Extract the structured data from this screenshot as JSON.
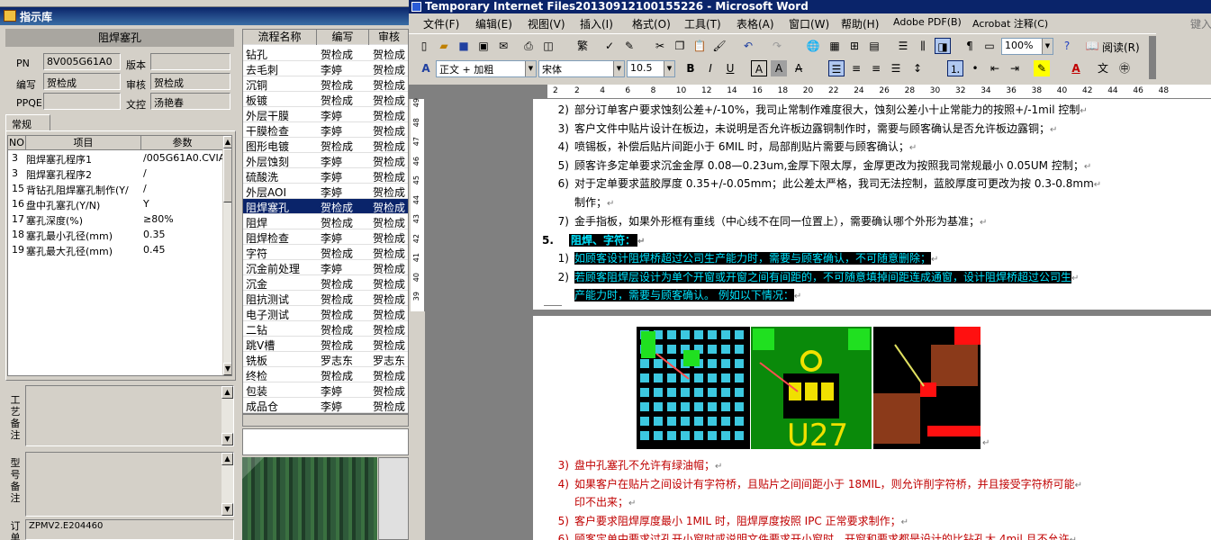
{
  "left_window": {
    "title": "指示库",
    "panel_title": "阻焊塞孔",
    "fields": {
      "pn_label": "PN",
      "pn_value": "8V005G61A0",
      "version_label": "版本",
      "version_value": "",
      "author_label": "编写",
      "author_value": "贺检成",
      "review_label": "审核",
      "review_value": "贺检成",
      "ppqe_label": "PPQE",
      "ppqe_value": "",
      "control_label": "文控",
      "control_value": "汤艳春"
    },
    "tab_regular": "常规",
    "grid_headers": [
      "NO",
      "项目",
      "参数"
    ],
    "grid_rows": [
      {
        "no": "3",
        "item": "阻焊塞孔程序1",
        "param": "/005G61A0.CVIA"
      },
      {
        "no": "3",
        "item": "阻焊塞孔程序2",
        "param": "/"
      },
      {
        "no": "15",
        "item": "背钻孔阻焊塞孔制作(Y/",
        "param": "/"
      },
      {
        "no": "16",
        "item": "盘中孔塞孔(Y/N)",
        "param": "Y"
      },
      {
        "no": "17",
        "item": "塞孔深度(%)",
        "param": "≥80%"
      },
      {
        "no": "18",
        "item": "塞孔最小孔径(mm)",
        "param": "0.35"
      },
      {
        "no": "19",
        "item": "塞孔最大孔径(mm)",
        "param": "0.45"
      }
    ],
    "memo1_label": "工艺备注",
    "memo2_label": "型号备注",
    "memo3_label": "订单",
    "memo3_value": "ZPMV2.E204460",
    "process_headers": [
      "流程名称",
      "编写",
      "审核"
    ],
    "process_rows": [
      {
        "name": "钻孔",
        "author": "贺检成",
        "review": "贺检成"
      },
      {
        "name": "去毛刺",
        "author": "李婷",
        "review": "贺检成"
      },
      {
        "name": "沉铜",
        "author": "贺检成",
        "review": "贺检成"
      },
      {
        "name": "板镀",
        "author": "贺检成",
        "review": "贺检成"
      },
      {
        "name": "外层干膜",
        "author": "李婷",
        "review": "贺检成"
      },
      {
        "name": "干膜检查",
        "author": "李婷",
        "review": "贺检成"
      },
      {
        "name": "图形电镀",
        "author": "贺检成",
        "review": "贺检成"
      },
      {
        "name": "外层蚀刻",
        "author": "李婷",
        "review": "贺检成"
      },
      {
        "name": "硫酸洗",
        "author": "李婷",
        "review": "贺检成"
      },
      {
        "name": "外层AOI",
        "author": "李婷",
        "review": "贺检成"
      },
      {
        "name": "阻焊塞孔",
        "author": "贺检成",
        "review": "贺检成"
      },
      {
        "name": "阻焊",
        "author": "贺检成",
        "review": "贺检成"
      },
      {
        "name": "阻焊检查",
        "author": "李婷",
        "review": "贺检成"
      },
      {
        "name": "字符",
        "author": "贺检成",
        "review": "贺检成"
      },
      {
        "name": "沉金前处理",
        "author": "李婷",
        "review": "贺检成"
      },
      {
        "name": "沉金",
        "author": "贺检成",
        "review": "贺检成"
      },
      {
        "name": "阻抗测试",
        "author": "贺检成",
        "review": "贺检成"
      },
      {
        "name": "电子测试",
        "author": "贺检成",
        "review": "贺检成"
      },
      {
        "name": "二钻",
        "author": "贺检成",
        "review": "贺检成"
      },
      {
        "name": "跳V槽",
        "author": "贺检成",
        "review": "贺检成"
      },
      {
        "name": "铣板",
        "author": "罗志东",
        "review": "罗志东"
      },
      {
        "name": "终检",
        "author": "贺检成",
        "review": "贺检成"
      },
      {
        "name": "包装",
        "author": "李婷",
        "review": "贺检成"
      },
      {
        "name": "成品仓",
        "author": "李婷",
        "review": "贺检成"
      }
    ]
  },
  "word": {
    "title": "Temporary Internet Files20130912100155226 - Microsoft Word",
    "right_hint": "键入",
    "menu": [
      "文件(F)",
      "编辑(E)",
      "视图(V)",
      "插入(I)",
      "格式(O)",
      "工具(T)",
      "表格(A)",
      "窗口(W)",
      "帮助(H)",
      "Adobe PDF(B)",
      "Acrobat 注释(C)"
    ],
    "zoom": "100%",
    "read_button": "阅读(R)",
    "style_combo": "正文 + 加粗",
    "font_combo": "宋体",
    "size_combo": "10.5",
    "ruler_numbers": [
      "2",
      "2",
      "4",
      "6",
      "8",
      "10",
      "12",
      "14",
      "16",
      "18",
      "20",
      "22",
      "24",
      "26",
      "28",
      "30",
      "32",
      "34",
      "36",
      "38",
      "40",
      "42",
      "44",
      "46",
      "48"
    ],
    "vruler_numbers": [
      "39",
      "40",
      "41",
      "42",
      "43",
      "44",
      "45",
      "46",
      "47",
      "48",
      "49"
    ],
    "page1_lines": [
      {
        "num": "2)",
        "text": "部分订单客户要求蚀刻公差+/-10%，我司止常制作难度很大，蚀刻公差小十止常能力的按照+/-1mil 控制"
      },
      {
        "num": "3)",
        "text": "客户文件中贴片设计在板边，未说明是否允许板边露铜制作时，需要与顾客确认是否允许板边露铜；"
      },
      {
        "num": "4)",
        "text": "喷锡板，补偿后贴片间距小于 6MIL 时，局部削贴片需要与顾客确认；"
      },
      {
        "num": "5)",
        "text": "顾客许多定单要求沉金金厚 0.08—0.23um,金厚下限太厚，金厚更改为按照我司常规最小 0.05UM 控制；"
      },
      {
        "num": "6)",
        "text": "对于定单要求蓝胶厚度 0.35+/-0.05mm；此公差太严格，我司无法控制，蓝胶厚度可更改为按 0.3-0.8mm"
      },
      {
        "num": "",
        "text": "制作；"
      },
      {
        "num": "7)",
        "text": "金手指板，如果外形框有重线（中心线不在同一位置上），需要确认哪个外形为基准；"
      }
    ],
    "section5_num": "5.",
    "section5_title": "阻焊、字符：",
    "section5_lines": [
      {
        "num": "1)",
        "text": "如顾客设计阻焊桥超过公司生产能力时，需要与顾客确认，不可随意删除；"
      },
      {
        "num": "2)",
        "text": "若顾客阻焊层设计为单个开窗或开窗之间有间距的，不可随意填掉间距连成通窗，设计阻焊桥超过公司生"
      },
      {
        "num": "",
        "text": "产能力时，需要与顾客确认。 例如以下情况："
      }
    ],
    "page2_lines": [
      {
        "num": "3)",
        "text": "盘中孔塞孔不允许有绿油帽；"
      },
      {
        "num": "4)",
        "text": "如果客户在贴片之间设计有字符桥，且贴片之间间距小于 18MIL，则允许削字符桥，并且接受字符桥可能"
      },
      {
        "num": "",
        "text": "印不出来；"
      },
      {
        "num": "5)",
        "text": "客户要求阻焊厚度最小 1MIL 时，阻焊厚度按照 IPC 正常要求制作；"
      },
      {
        "num": "6)",
        "text": "顾客定单中要求过孔开小窗时或说明文件要求开小窗时，开窗和要求都是设计的比钻孔大 4mil,且不允许"
      }
    ],
    "pcb_label": "U27",
    "colors": {
      "highlight_bg": "#000000",
      "highlight_fg": "#00e5ff",
      "red_text": "#c00000",
      "titlebar": "#0a246a",
      "selection": "#0a246a"
    }
  }
}
